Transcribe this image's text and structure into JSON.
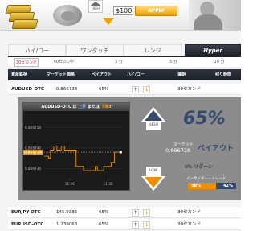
{
  "banner": {
    "hi_label": "HIGH",
    "amount": "$100",
    "apply_label": "APPLY"
  },
  "tabs": [
    {
      "label": "ハイ/ロー"
    },
    {
      "label": "ワンタッチ"
    },
    {
      "label": "レンジ"
    },
    {
      "label": "Hyper"
    }
  ],
  "sub_tabs": [
    {
      "label": "30セカンド"
    },
    {
      "label": "60セカンド"
    },
    {
      "label": "2 分"
    },
    {
      "label": "5 分"
    },
    {
      "label": "10 分"
    }
  ],
  "table": {
    "headers": [
      "資産銘柄",
      "マーケット価格",
      "ペイアウト",
      "ハイ/ロー",
      "満期",
      "残り時間"
    ],
    "rows": [
      {
        "asset": "AUDUSD-OTC",
        "price": "0.866738",
        "payout": "65%",
        "expiry": "30セカンド"
      },
      {
        "asset": "EURJPY-OTC",
        "price": "145.9386",
        "payout": "65%",
        "expiry": "30セカンド"
      },
      {
        "asset": "EURUSD-OTC",
        "price": "1.239063",
        "payout": "65%",
        "expiry": "30セカンド"
      }
    ]
  },
  "detail": {
    "title_parts": [
      "AUDUSD-OTC は ",
      "上昇",
      " または ",
      "下降",
      "?"
    ],
    "market_label": "マーケット",
    "market_value": "0.866738",
    "payout_pct": "65%",
    "payout_label": "ペイアウト",
    "return_label": "0%  リターン",
    "sentiment_label": "インサイダー・トレード",
    "sentiment_high_pct": "58%",
    "sentiment_low_pct": "42%",
    "high_label": "HIGH",
    "low_label": "LOW",
    "up_arrow": "↑",
    "down_arrow": "↓"
  },
  "colors": {
    "accent_orange": "#f09000",
    "navy": "#344a6d",
    "dark_header": "#1f232a",
    "chart_line": "#f09000"
  },
  "chart_data": {
    "type": "line",
    "title": "",
    "xlabel": "",
    "ylabel": "",
    "y_ticks": [
      "0.866750",
      "0.866740",
      "0.866738",
      "0.866730"
    ],
    "x_ticks": [
      "11:26",
      "11:30"
    ],
    "ylim": [
      0.866725,
      0.866755
    ],
    "current_value": "0.866738",
    "points": [
      [
        0,
        0.866736
      ],
      [
        4,
        0.866736
      ],
      [
        4,
        0.866735
      ],
      [
        6,
        0.866735
      ],
      [
        6,
        0.866739
      ],
      [
        9,
        0.866739
      ],
      [
        9,
        0.866741
      ],
      [
        12,
        0.866741
      ],
      [
        12,
        0.866739
      ],
      [
        16,
        0.866739
      ],
      [
        16,
        0.866741
      ],
      [
        19,
        0.866741
      ],
      [
        19,
        0.866739
      ],
      [
        30,
        0.866739
      ],
      [
        30,
        0.866731
      ],
      [
        37,
        0.866731
      ],
      [
        37,
        0.866729
      ],
      [
        48,
        0.866729
      ],
      [
        48,
        0.866731
      ],
      [
        50,
        0.866731
      ],
      [
        50,
        0.866729
      ],
      [
        56,
        0.866729
      ],
      [
        56,
        0.866731
      ],
      [
        63,
        0.866731
      ],
      [
        63,
        0.866733
      ],
      [
        66,
        0.866733
      ],
      [
        66,
        0.866738
      ],
      [
        72,
        0.866738
      ]
    ]
  }
}
